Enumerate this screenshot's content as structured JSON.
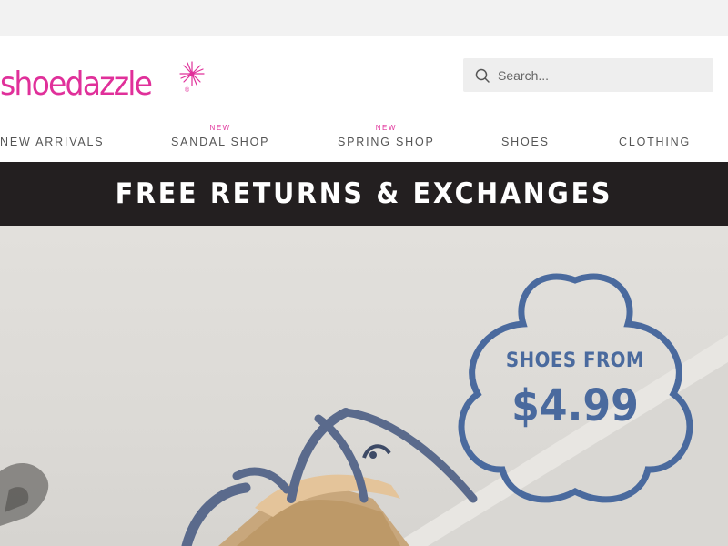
{
  "brand": {
    "logo_text": "shoedazzle",
    "logo_mark": "®",
    "primary_color": "#e0309a"
  },
  "search": {
    "placeholder": "Search..."
  },
  "nav": {
    "items": [
      {
        "label": "NEW ARRIVALS",
        "badge": ""
      },
      {
        "label": "SANDAL SHOP",
        "badge": "NEW"
      },
      {
        "label": "SPRING SHOP",
        "badge": "NEW"
      },
      {
        "label": "SHOES",
        "badge": ""
      },
      {
        "label": "CLOTHING",
        "badge": ""
      }
    ]
  },
  "promo": {
    "text": "FREE RETURNS & EXCHANGES",
    "background": "#231f20"
  },
  "hero": {
    "badge_line1": "SHOES FROM",
    "badge_line2": "$4.99",
    "badge_color": "#4a6a9e",
    "image": "denim-strappy-sandal-photo"
  },
  "icons": {
    "search": "search-icon",
    "sparkle": "sparkle-icon"
  }
}
